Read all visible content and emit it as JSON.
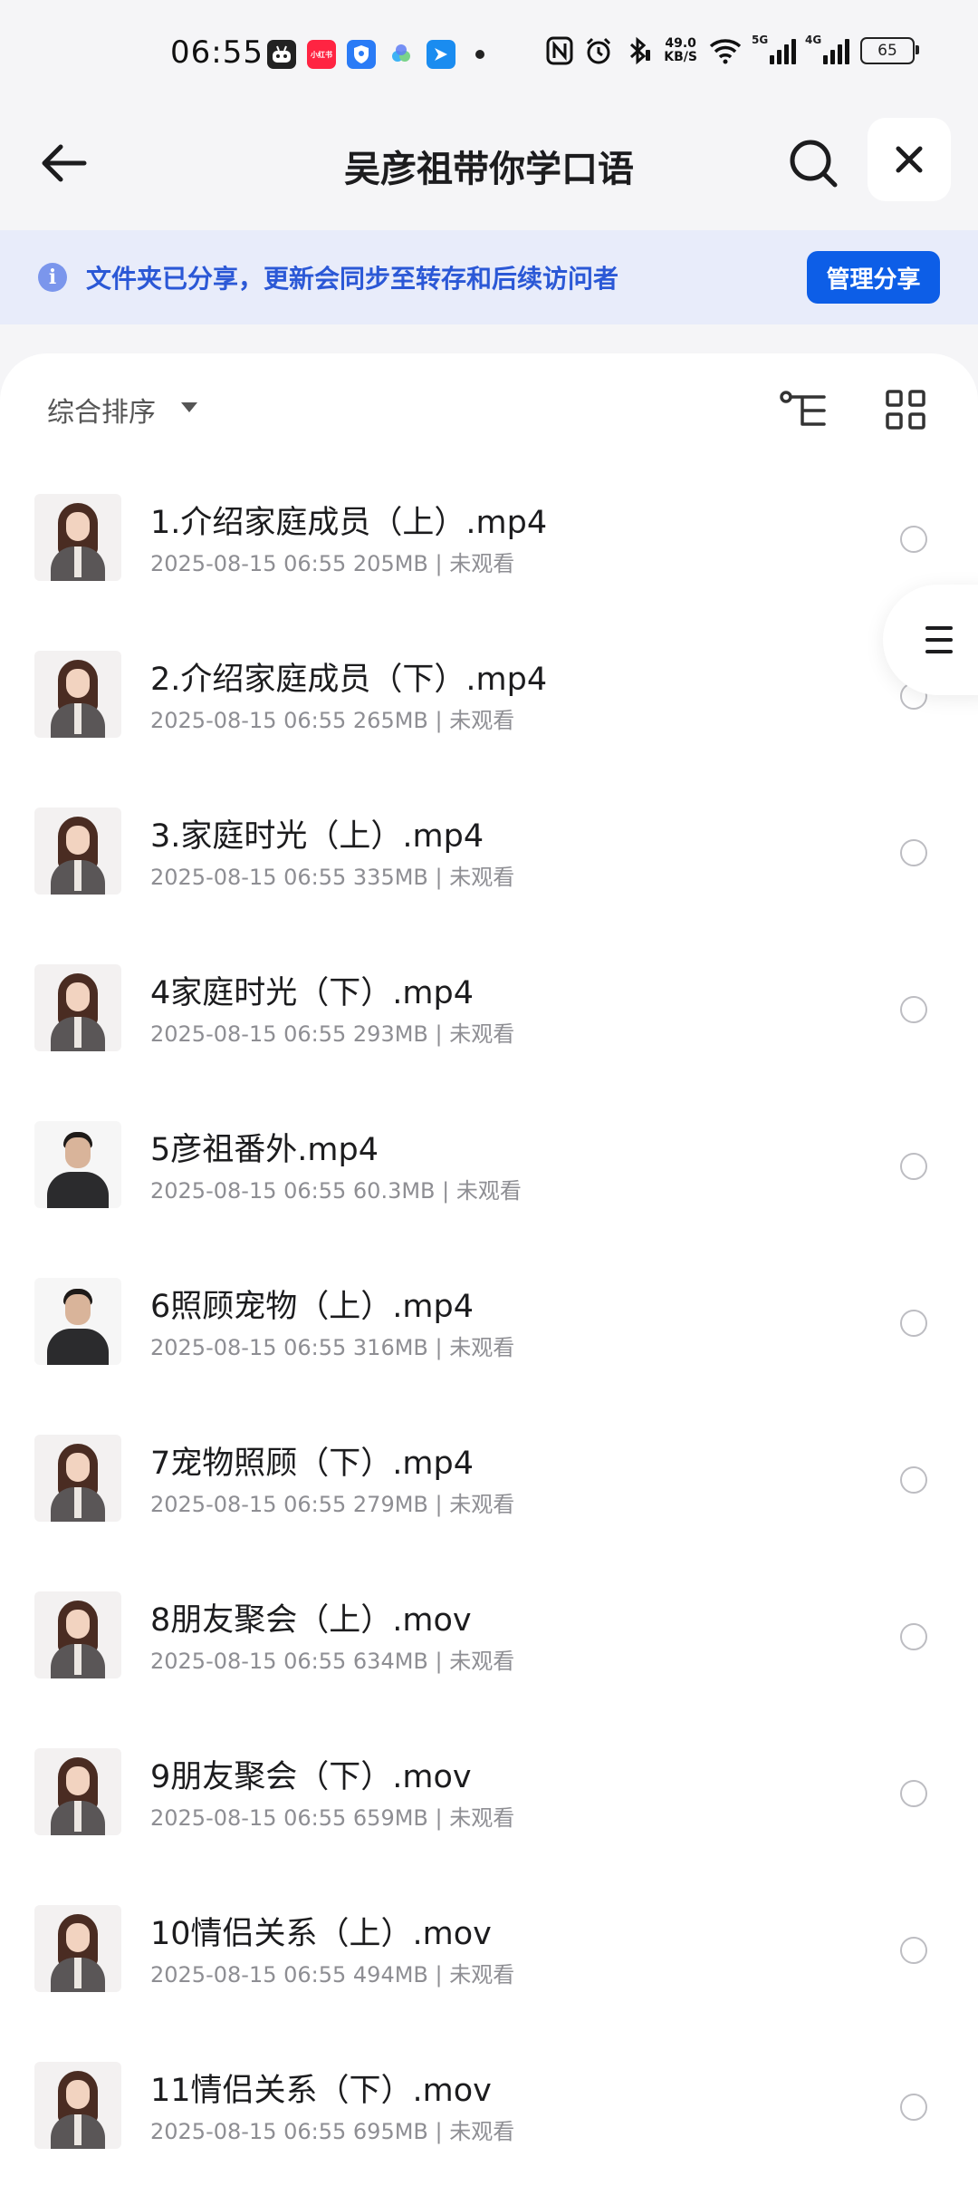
{
  "status_bar": {
    "time": "06:55",
    "app_badge_label": "小红书",
    "net_speed_value": "49.0",
    "net_speed_unit": "KB/S",
    "signal1_label": "5G",
    "signal2_label": "4G",
    "battery": "65"
  },
  "header": {
    "title": "吴彦祖带你学口语",
    "icons": {
      "back": "arrow-left-icon",
      "search": "search-icon",
      "close": "close-icon"
    }
  },
  "banner": {
    "text": "文件夹已分享，更新会同步至转存和后续访问者",
    "button_label": "管理分享",
    "colors": {
      "background": "#e8ecfa",
      "text": "#2b58d6",
      "button": "#0d5ee7"
    }
  },
  "toolbar": {
    "sort_label": "综合排序",
    "icons": {
      "tree": "tree-view-icon",
      "grid": "grid-view-icon"
    }
  },
  "files": [
    {
      "name": "1.介绍家庭成员（上）.mp4",
      "meta": "2025-08-15 06:55  205MB | 未观看",
      "thumb": "female"
    },
    {
      "name": "2.介绍家庭成员（下）.mp4",
      "meta": "2025-08-15 06:55  265MB | 未观看",
      "thumb": "female"
    },
    {
      "name": "3.家庭时光（上）.mp4",
      "meta": "2025-08-15 06:55  335MB | 未观看",
      "thumb": "female"
    },
    {
      "name": "4家庭时光（下）.mp4",
      "meta": "2025-08-15 06:55  293MB | 未观看",
      "thumb": "female"
    },
    {
      "name": "5彦祖番外.mp4",
      "meta": "2025-08-15 06:55  60.3MB | 未观看",
      "thumb": "male"
    },
    {
      "name": "6照顾宠物（上）.mp4",
      "meta": "2025-08-15 06:55  316MB | 未观看",
      "thumb": "male"
    },
    {
      "name": "7宠物照顾（下）.mp4",
      "meta": "2025-08-15 06:55  279MB | 未观看",
      "thumb": "female"
    },
    {
      "name": "8朋友聚会（上）.mov",
      "meta": "2025-08-15 06:55  634MB | 未观看",
      "thumb": "female"
    },
    {
      "name": "9朋友聚会（下）.mov",
      "meta": "2025-08-15 06:55  659MB | 未观看",
      "thumb": "female"
    },
    {
      "name": "10情侣关系（上）.mov",
      "meta": "2025-08-15 06:55  494MB | 未观看",
      "thumb": "female"
    },
    {
      "name": "11情侣关系（下）.mov",
      "meta": "2025-08-15 06:55  695MB | 未观看",
      "thumb": "female"
    }
  ],
  "side_tab": {
    "icon": "menu-icon"
  }
}
